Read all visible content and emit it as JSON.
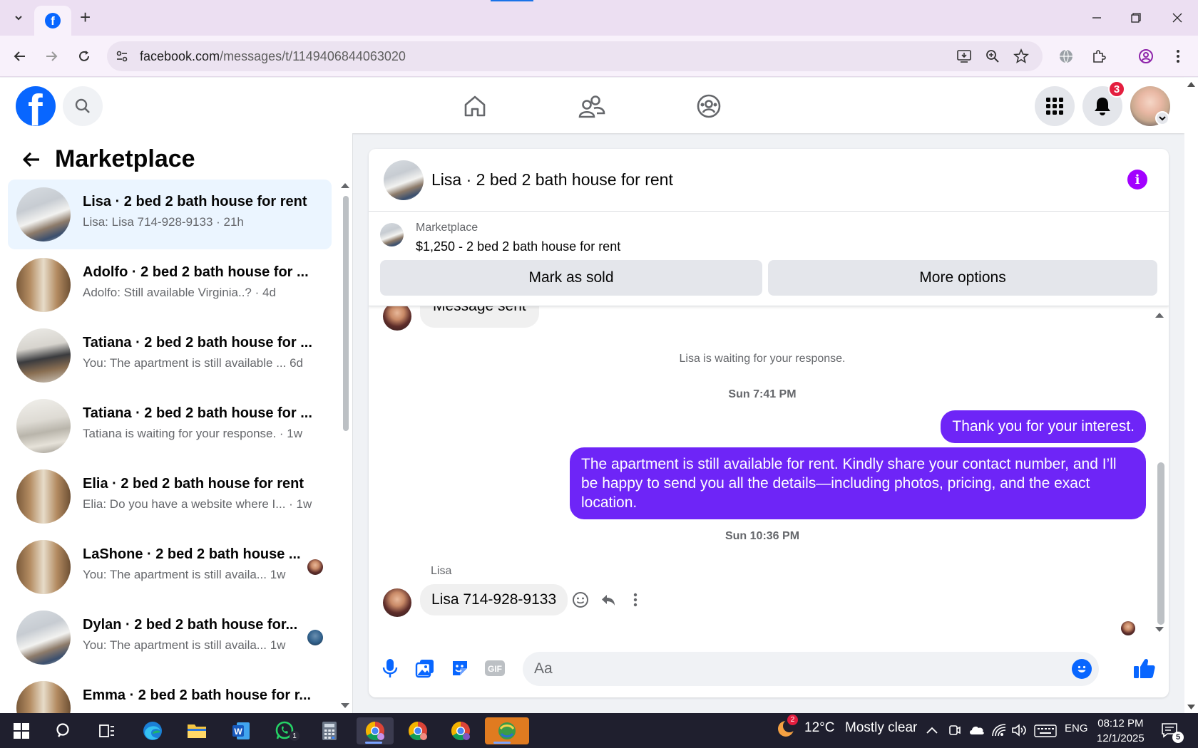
{
  "browser": {
    "url_domain": "facebook.com",
    "url_path": "/messages/t/1149406844063020"
  },
  "header": {
    "notifications_count": "3"
  },
  "left_panel": {
    "title": "Marketplace",
    "conversations": [
      {
        "name": "Lisa · 2 bed 2 bath house for rent",
        "snippet": "Lisa: Lisa 714-928-9133 · 21h",
        "active": true
      },
      {
        "name": "Adolfo · 2 bed 2 bath house for ...",
        "snippet": "Adolfo: Still available Virginia..? · 4d"
      },
      {
        "name": "Tatiana · 2 bed 2 bath house for ...",
        "snippet": "You: The apartment is still available ...  6d"
      },
      {
        "name": "Tatiana · 2 bed 2 bath house for ...",
        "snippet": "Tatiana is waiting for your response. · 1w"
      },
      {
        "name": "Elia · 2 bed 2 bath house for rent",
        "snippet": "Elia: Do you have a website where I... · 1w"
      },
      {
        "name": "LaShone · 2 bed 2 bath house ...",
        "snippet": "You: The apartment is still availa...   1w"
      },
      {
        "name": "Dylan · 2 bed 2 bath house for...",
        "snippet": "You: The apartment is still availa...   1w"
      },
      {
        "name": "Emma · 2 bed 2 bath house for r...",
        "snippet": ""
      }
    ]
  },
  "chat": {
    "title": "Lisa · 2 bed 2 bath house for rent",
    "listing": {
      "category": "Marketplace",
      "title": "$1,250 - 2 bed 2 bath house for rent",
      "mark_sold_label": "Mark as sold",
      "more_options_label": "More options"
    },
    "messages": {
      "partial_in": "Message sent",
      "waiting": "Lisa is waiting for your response.",
      "ts1": "Sun 7:41 PM",
      "out1": "Thank you for your interest.",
      "out2": "The apartment is still available for rent. Kindly share your contact number, and I’ll be happy to send you all the details—including photos, pricing, and the exact location.",
      "ts2": "Sun 10:36 PM",
      "sender": "Lisa",
      "in1": "Lisa 714-928-9133"
    },
    "composer": {
      "placeholder": "Aa"
    }
  },
  "taskbar": {
    "weather_temp": "12°C",
    "weather_desc": "Mostly clear",
    "weather_badge": "2",
    "whatsapp_badge": "1",
    "language": "ENG",
    "time": "08:12 PM",
    "date": "12/1/2025",
    "notif_count": "5"
  },
  "colors": {
    "fb_blue": "#0866ff",
    "messenger_purple": "#6e25f7",
    "active_conv_bg": "#ebf5ff",
    "badge_red": "#e41e3f"
  }
}
